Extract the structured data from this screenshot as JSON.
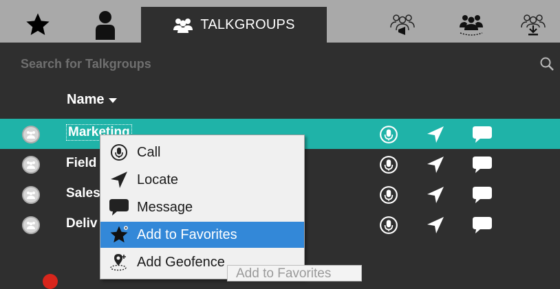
{
  "tabs": {
    "favorites_icon": "star-icon",
    "contacts_icon": "person-icon",
    "talkgroups_label": "TALKGROUPS",
    "talkgroups_icon": "group-icon",
    "tab4_icon": "group-broadcast-icon",
    "tab5_icon": "group-geofence-icon",
    "tab6_icon": "group-download-icon"
  },
  "search": {
    "placeholder": "Search for Talkgroups",
    "value": ""
  },
  "table": {
    "column_header": "Name",
    "sort_icon": "caret-down-icon",
    "rows": [
      {
        "name": "Marketing",
        "selected": true
      },
      {
        "name": "Field",
        "selected": false
      },
      {
        "name": "Sales",
        "selected": false
      },
      {
        "name": "Deliv",
        "selected": false
      }
    ]
  },
  "context_menu": {
    "items": [
      {
        "label": "Call",
        "icon": "call-icon"
      },
      {
        "label": "Locate",
        "icon": "locate-icon"
      },
      {
        "label": "Message",
        "icon": "message-icon"
      },
      {
        "label": "Add to Favorites",
        "icon": "star-icon",
        "highlighted": true
      },
      {
        "label": "Add Geofence",
        "icon": "geofence-icon"
      }
    ]
  },
  "tooltip": {
    "text": "Add to Favorites"
  },
  "colors": {
    "accent": "#1fb3a8",
    "menu_highlight": "#3388d8",
    "background": "#2f2f2f",
    "tab_bar": "#a9a9a9"
  }
}
